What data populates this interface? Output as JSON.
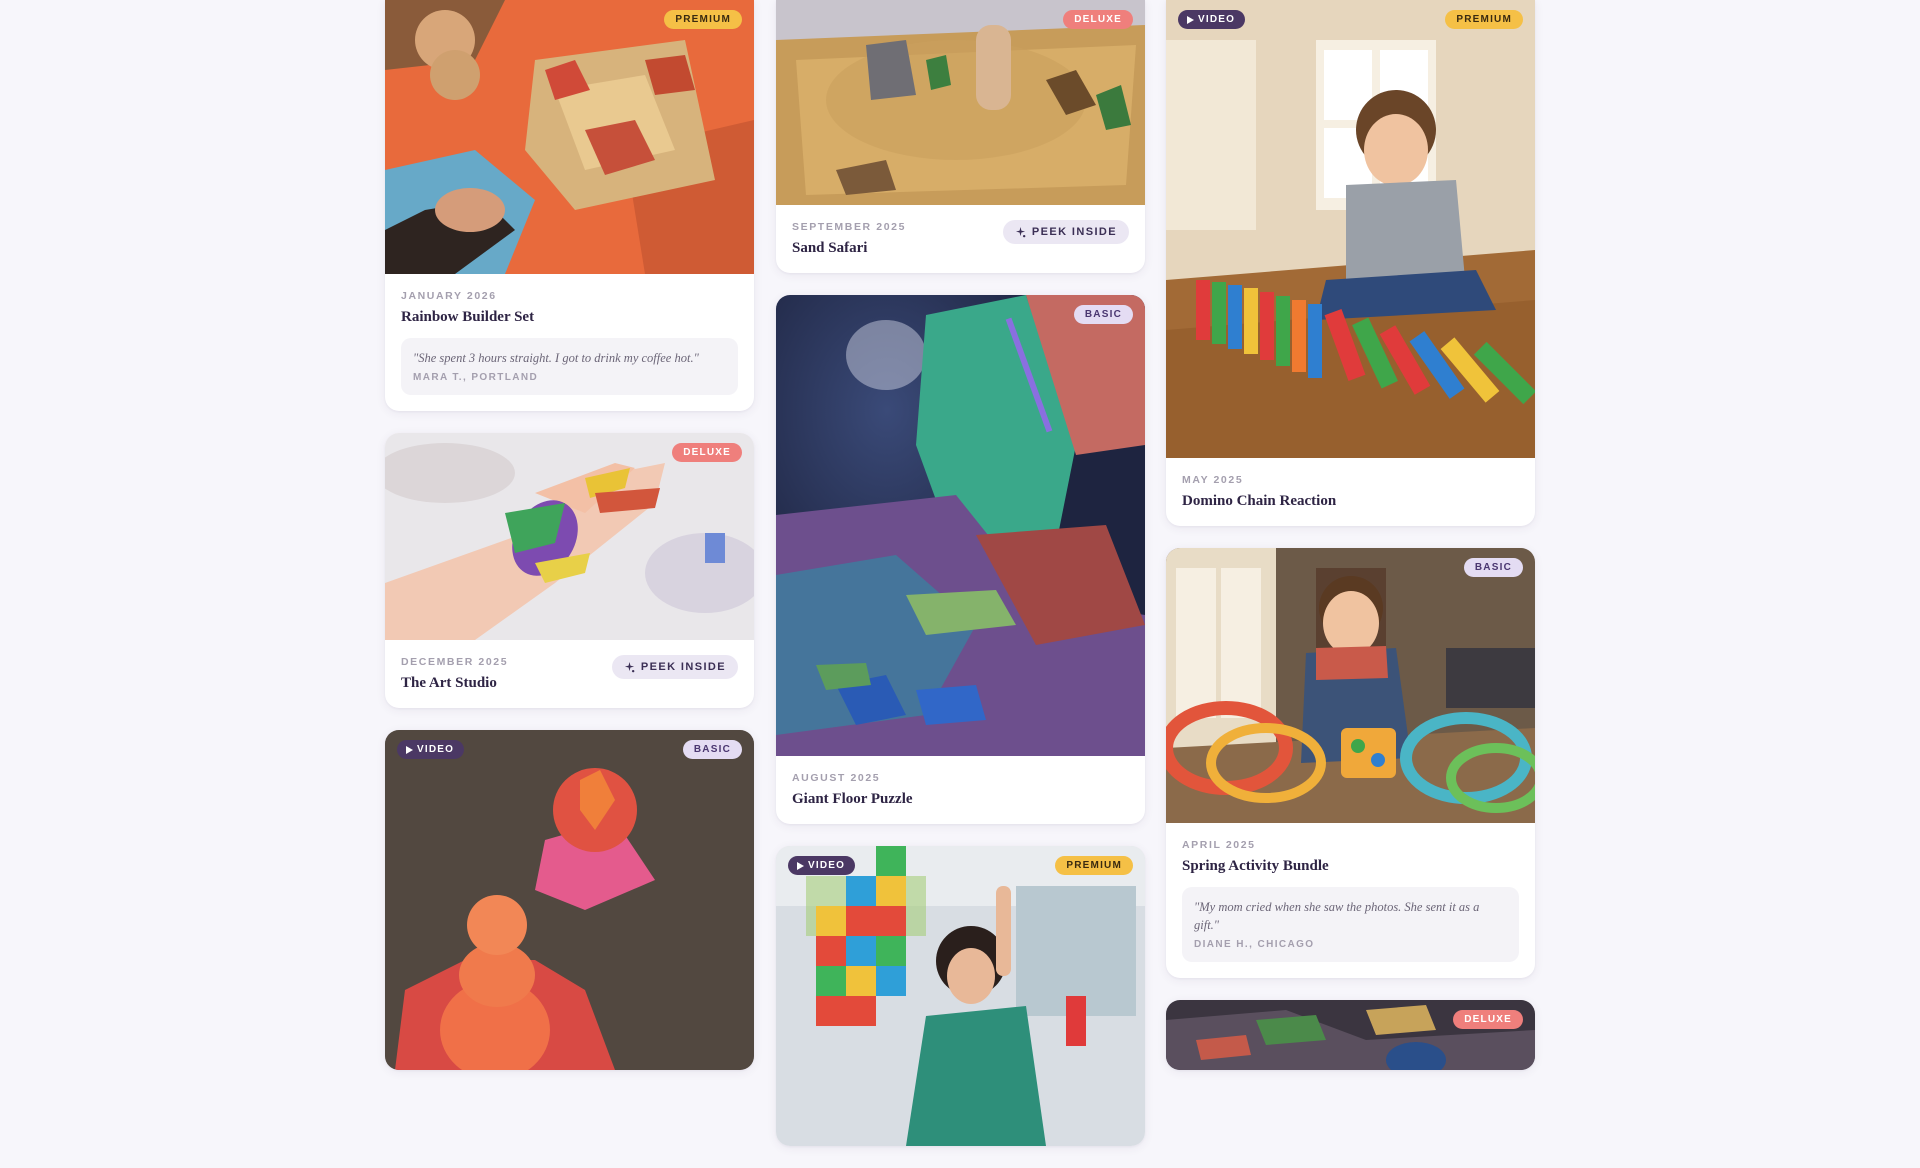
{
  "cards": [
    {
      "badge": "PREMIUM",
      "date": "JANUARY 2026",
      "title": "Rainbow Builder Set",
      "quote": "\"She spent 3 hours straight. I got to drink my coffee hot.\"",
      "quote_author": "MARA T., PORTLAND"
    },
    {
      "badge": "DELUXE",
      "date": "DECEMBER 2025",
      "title": "The Art Studio",
      "peek_label": "PEEK INSIDE"
    },
    {
      "video_label": "VIDEO",
      "badge": "BASIC"
    },
    {
      "badge": "DELUXE",
      "date": "SEPTEMBER 2025",
      "title": "Sand Safari",
      "peek_label": "PEEK INSIDE"
    },
    {
      "badge": "BASIC",
      "date": "AUGUST 2025",
      "title": "Giant Floor Puzzle"
    },
    {
      "video_label": "VIDEO",
      "badge": "PREMIUM"
    },
    {
      "video_label": "VIDEO",
      "badge": "PREMIUM",
      "date": "MAY 2025",
      "title": "Domino Chain Reaction"
    },
    {
      "badge": "BASIC",
      "date": "APRIL 2025",
      "title": "Spring Activity Bundle",
      "quote": "\"My mom cried when she saw the photos. She sent it as a gift.\"",
      "quote_author": "DIANE H., CHICAGO"
    },
    {
      "badge": "DELUXE"
    }
  ]
}
